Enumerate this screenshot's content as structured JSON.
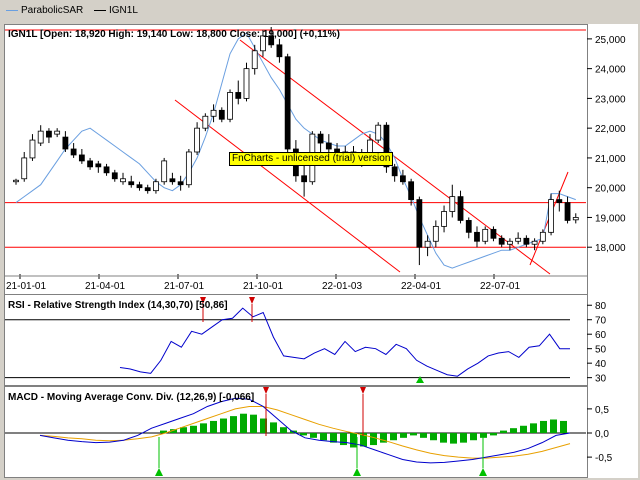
{
  "legend": [
    {
      "label": "ParabolicSAR",
      "color": "#6a9fe0"
    },
    {
      "label": "IGN1L",
      "color": "#000000"
    }
  ],
  "watermark": "FnCharts - unlicensed (trial) version",
  "price_panel": {
    "title": "IGN1L [Open: 18,920  High: 19,140  Low: 18,800  Close: 19,000] (+0,11%)",
    "y_ticks": [
      "25,000",
      "24,000",
      "23,000",
      "22,000",
      "21,000",
      "20,000",
      "19,000",
      "18,000"
    ],
    "x_ticks": [
      "21-01-01",
      "21-04-01",
      "21-07-01",
      "21-10-01",
      "22-01-03",
      "22-04-01",
      "22-07-01"
    ]
  },
  "rsi_panel": {
    "title": "RSI - Relative Strength Index (14,30,70) [50,86]",
    "y_ticks": [
      "80",
      "70",
      "60",
      "50",
      "40",
      "30"
    ]
  },
  "macd_panel": {
    "title": "MACD - Moving Average Conv. Div. (12,26,9) [-0,066]",
    "y_ticks": [
      "0,5",
      "0,0",
      "-0,5"
    ]
  },
  "colors": {
    "up": "#ffffff",
    "down": "#000000",
    "sar": "#6a9fe0",
    "level": "#ff0000",
    "rsi": "#0000cc",
    "macd": "#0000cc",
    "signal": "#e8a000",
    "hist": "#00aa00",
    "buy": "#00c000",
    "sell": "#d00000"
  },
  "chart_data": [
    {
      "type": "candlestick",
      "title": "IGN1L [Open: 18,920  High: 19,140  Low: 18,800  Close: 19,000] (+0,11%)",
      "ylim": [
        17100,
        25500
      ],
      "x": [
        "21-01-01",
        "21-04-01",
        "21-07-01",
        "21-10-01",
        "22-01-03",
        "22-04-01",
        "22-07-01"
      ],
      "candles": [
        [
          20200,
          20300,
          20100,
          20250
        ],
        [
          20300,
          21200,
          20200,
          21000
        ],
        [
          21000,
          21800,
          20900,
          21600
        ],
        [
          21500,
          22100,
          21400,
          21900
        ],
        [
          21900,
          22000,
          21500,
          21700
        ],
        [
          21800,
          22000,
          21700,
          21900
        ],
        [
          21700,
          21900,
          21200,
          21300
        ],
        [
          21300,
          21500,
          21000,
          21100
        ],
        [
          21100,
          21300,
          20800,
          20900
        ],
        [
          20900,
          21000,
          20600,
          20700
        ],
        [
          20800,
          20900,
          20500,
          20700
        ],
        [
          20700,
          20800,
          20400,
          20500
        ],
        [
          20500,
          20600,
          20200,
          20300
        ],
        [
          20200,
          20500,
          20100,
          20300
        ],
        [
          20200,
          20400,
          20000,
          20100
        ],
        [
          20100,
          20200,
          19900,
          20000
        ],
        [
          20000,
          20100,
          19800,
          19900
        ],
        [
          19900,
          20300,
          19800,
          20200
        ],
        [
          20200,
          21000,
          20100,
          20900
        ],
        [
          20300,
          20500,
          20100,
          20200
        ],
        [
          20200,
          20400,
          19900,
          20100
        ],
        [
          20100,
          21300,
          20000,
          21200
        ],
        [
          21200,
          22200,
          21100,
          22000
        ],
        [
          22000,
          22500,
          21900,
          22400
        ],
        [
          22400,
          22800,
          22200,
          22600
        ],
        [
          22600,
          22700,
          22200,
          22300
        ],
        [
          22300,
          23300,
          22200,
          23200
        ],
        [
          23200,
          23600,
          22800,
          23000
        ],
        [
          23000,
          24200,
          22900,
          24000
        ],
        [
          24000,
          24800,
          23800,
          24600
        ],
        [
          24600,
          25300,
          24400,
          25100
        ],
        [
          25100,
          25400,
          24700,
          24800
        ],
        [
          24800,
          25000,
          24200,
          24400
        ],
        [
          24400,
          24500,
          21000,
          21300
        ],
        [
          21300,
          21600,
          20200,
          20400
        ],
        [
          20400,
          20800,
          19700,
          20200
        ],
        [
          20200,
          21900,
          20100,
          21800
        ],
        [
          21800,
          21900,
          21200,
          21500
        ],
        [
          21500,
          21800,
          21100,
          21300
        ],
        [
          21300,
          21500,
          20900,
          21100
        ],
        [
          21100,
          21400,
          20900,
          21200
        ],
        [
          21200,
          21400,
          20800,
          21000
        ],
        [
          21000,
          21300,
          20700,
          21100
        ],
        [
          21100,
          21800,
          21000,
          21600
        ],
        [
          21600,
          22200,
          21500,
          22100
        ],
        [
          22100,
          22200,
          20500,
          20700
        ],
        [
          20700,
          20800,
          20200,
          20400
        ],
        [
          20400,
          20600,
          20100,
          20200
        ],
        [
          20200,
          20300,
          19400,
          19600
        ],
        [
          19600,
          19700,
          17400,
          18000
        ],
        [
          18000,
          18400,
          17700,
          18200
        ],
        [
          18200,
          18900,
          18000,
          18700
        ],
        [
          18700,
          19400,
          18500,
          19200
        ],
        [
          19200,
          20100,
          19000,
          19700
        ],
        [
          19700,
          19900,
          18800,
          18900
        ],
        [
          18900,
          19000,
          18300,
          18500
        ],
        [
          18500,
          18700,
          18000,
          18200
        ],
        [
          18200,
          18700,
          18100,
          18600
        ],
        [
          18600,
          18700,
          18200,
          18300
        ],
        [
          18300,
          18400,
          18000,
          18100
        ],
        [
          18100,
          18300,
          17900,
          18200
        ],
        [
          18200,
          18500,
          18100,
          18300
        ],
        [
          18300,
          18400,
          18000,
          18100
        ],
        [
          18100,
          18300,
          17900,
          18200
        ],
        [
          18200,
          18600,
          18100,
          18500
        ],
        [
          18500,
          19800,
          18400,
          19600
        ],
        [
          19600,
          19900,
          19200,
          19500
        ],
        [
          19500,
          19700,
          18800,
          18900
        ],
        [
          18920,
          19140,
          18800,
          19000
        ]
      ],
      "sar": [
        19500,
        19700,
        19900,
        20100,
        20500,
        20900,
        21300,
        21600,
        21900,
        22000,
        21800,
        21600,
        21400,
        21200,
        21000,
        20800,
        20500,
        20200,
        20000,
        19900,
        20100,
        20500,
        21000,
        21700,
        22500,
        23500,
        24500,
        25000,
        25200,
        24700,
        24200,
        23700,
        23300,
        22800,
        22300,
        22000,
        21800,
        21600,
        21500,
        21400,
        21400,
        21600,
        21800,
        21900,
        21800,
        21500,
        21000,
        20300,
        19700,
        19000,
        18400,
        17800,
        17400,
        17300,
        17400,
        17500,
        17600,
        17700,
        17800,
        17900,
        17900,
        18000,
        18100,
        18200,
        18300,
        19800,
        19800,
        19700,
        19600
      ],
      "levels": [
        25300,
        19500,
        18000
      ]
    },
    {
      "type": "line",
      "title": "RSI - Relative Strength Index (14,30,70) [50,86]",
      "ylim": [
        27,
        85
      ],
      "thresholds": [
        30,
        70
      ],
      "values": [
        37,
        36,
        34,
        33,
        42,
        55,
        51,
        62,
        60,
        65,
        70,
        71,
        78,
        72,
        75,
        58,
        45,
        44,
        43,
        47,
        50,
        46,
        55,
        48,
        51,
        50,
        46,
        53,
        50,
        42,
        38,
        35,
        32,
        31,
        36,
        40,
        45,
        47,
        48,
        44,
        51,
        52,
        60,
        50,
        50
      ]
    },
    {
      "type": "line",
      "title": "MACD - Moving Average Conv. Div. (12,26,9) [-0,066]",
      "ylim": [
        -0.85,
        0.85
      ],
      "macd": [
        -0.05,
        -0.1,
        -0.15,
        -0.18,
        -0.2,
        -0.19,
        -0.15,
        -0.05,
        0.1,
        0.2,
        0.3,
        0.4,
        0.55,
        0.65,
        0.72,
        0.7,
        0.55,
        0.3,
        0.05,
        -0.1,
        -0.15,
        -0.18,
        -0.2,
        -0.25,
        -0.35,
        -0.45,
        -0.55,
        -0.6,
        -0.62,
        -0.61,
        -0.58,
        -0.55,
        -0.5,
        -0.45,
        -0.4,
        -0.32,
        -0.2,
        -0.05,
        0.0
      ],
      "signal": [
        -0.05,
        -0.07,
        -0.1,
        -0.12,
        -0.15,
        -0.16,
        -0.15,
        -0.12,
        -0.08,
        0.0,
        0.1,
        0.2,
        0.3,
        0.4,
        0.5,
        0.55,
        0.55,
        0.48,
        0.38,
        0.28,
        0.18,
        0.1,
        0.03,
        -0.03,
        -0.1,
        -0.18,
        -0.27,
        -0.35,
        -0.42,
        -0.47,
        -0.5,
        -0.52,
        -0.52,
        -0.5,
        -0.48,
        -0.44,
        -0.38,
        -0.3,
        -0.22
      ],
      "histogram": [
        0.05,
        0.08,
        0.12,
        0.15,
        0.2,
        0.25,
        0.3,
        0.35,
        0.4,
        0.38,
        0.3,
        0.22,
        0.12,
        0.05,
        -0.05,
        -0.1,
        -0.15,
        -0.2,
        -0.25,
        -0.3,
        -0.28,
        -0.25,
        -0.2,
        -0.15,
        -0.1,
        -0.05,
        -0.1,
        -0.15,
        -0.2,
        -0.22,
        -0.2,
        -0.15,
        -0.1,
        -0.05,
        0.05,
        0.1,
        0.15,
        0.2,
        0.25,
        0.28,
        0.25
      ]
    }
  ]
}
